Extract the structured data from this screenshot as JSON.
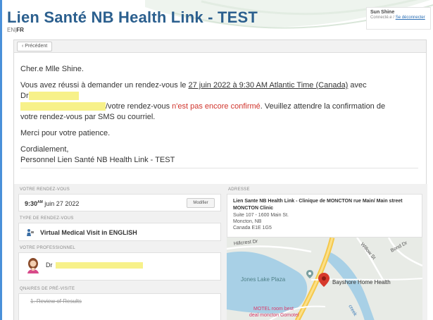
{
  "header": {
    "title": "Lien Santé NB Health Link - TEST",
    "lang_en": "EN",
    "lang_sep": "|",
    "lang_fr": "FR",
    "user_name": "Sun Shine",
    "user_status": "Connecté.e /",
    "logout_label": "Se déconnecter"
  },
  "toolbar": {
    "back_label": "‹ Précédent"
  },
  "message": {
    "greeting": "Cher.e Mlle Shine.",
    "line1_prefix": "Vous avez réussi à demander un rendez-vous le ",
    "line1_date": "27 juin 2022 à 9:30 AM Atlantic Time (Canada)",
    "line1_suffix": " avec Dr",
    "line2_redacted": "xxxxxxxxxxxxxxxxxxxxxx",
    "line2_text": "/votre rendez-vous ",
    "line2_red": "n'est pas encore confirmé",
    "line2_after": ". Veuillez attendre la confirmation de",
    "line3": "votre rendez-vous par SMS ou courriel.",
    "thanks": "Merci pour votre patience.",
    "regards": "Cordialement,",
    "signature": "Personnel Lien Santé NB Health Link - TEST"
  },
  "appointment": {
    "label": "VOTRE RENDEZ-VOUS",
    "time": "9:30",
    "ampm": "AM",
    "date": " juin 27 2022",
    "modify_label": "Modifier"
  },
  "type": {
    "label": "TYPE DE RENDEZ-VOUS",
    "value": "Virtual Medical Visit in ENGLISH"
  },
  "professional": {
    "label": "VOTRE PROFESSIONNEL",
    "prefix": "Dr"
  },
  "questionnaire": {
    "label": "QNAIRES DE PRÉ-VISITE",
    "item": "1. Review of Results"
  },
  "address": {
    "label": "ADRESSE",
    "name": "Lien Sante NB Health Link - Clinique de MONCTON rue Main/ Main street MONCTON Clinic",
    "line1": "Suite 107 - 1600 Main St.",
    "line2": "Moncton, NB",
    "line3": "Canada E1E 1G5"
  },
  "map": {
    "street1": "Hillcrest Dr",
    "street2": "Willow St",
    "street3": "Bond Dr",
    "place1": "Jones Lake Plaza",
    "place2": "Bayshore Home Health",
    "place3": "MOTEL room best",
    "place4": "deal moncton Gomotel",
    "street4": "creek"
  },
  "colors": {
    "title_blue": "#2b5f8e",
    "confirm_red": "#d0342c",
    "redaction_yellow": "#f7f18a",
    "water": "#a8d0e6",
    "pin": "#d6392c"
  }
}
